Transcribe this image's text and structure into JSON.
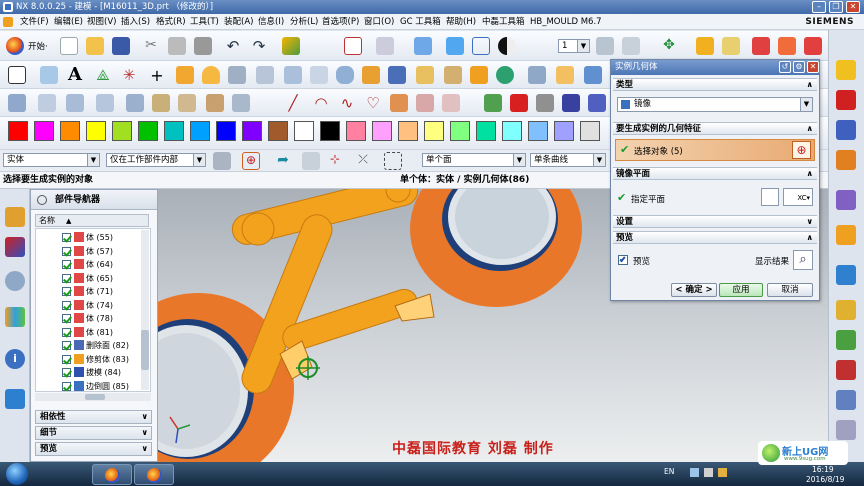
{
  "window": {
    "title": "NX 8.0.0.25 - 建模 - [M16011_3D.prt （修改的）]",
    "brand": "SIEMENS",
    "min": "–",
    "restore": "❐",
    "close": "✕"
  },
  "menu": [
    "文件(F)",
    "编辑(E)",
    "视图(V)",
    "插入(S)",
    "格式(R)",
    "工具(T)",
    "装配(A)",
    "信息(I)",
    "分析(L)",
    "首选项(P)",
    "窗口(O)",
    "GC 工具箱",
    "帮助(H)",
    "中磊工具箱",
    "HB_MOULD M6.7"
  ],
  "toolbar": {
    "start_label": "开始·",
    "layer_value": "1"
  },
  "palette": [
    "#ff0000",
    "#ff00ff",
    "#ff8c00",
    "#ffff00",
    "#a0e020",
    "#00c000",
    "#00c0c0",
    "#00a0ff",
    "#0000ff",
    "#8000ff",
    "#a05a2c",
    "#ffffff",
    "#000000",
    "#ff80a0",
    "#ffa0ff",
    "#ffc080",
    "#ffff80",
    "#80ff80",
    "#00e0a0",
    "#80ffff",
    "#80c0ff",
    "#a0a0ff",
    "#e0e0e0"
  ],
  "selection": {
    "type_filter": "实体",
    "scope": "仅在工作部件内部",
    "body_rule": "单个面",
    "curve_rule": "单条曲线"
  },
  "status": {
    "prompt": "选择要生成实例的对象",
    "message": "单个体：实体 / 实例几何体(86)"
  },
  "navigator": {
    "title": "部件导航器",
    "column": "名称",
    "rows": [
      {
        "label": "体 (55)"
      },
      {
        "label": "体 (57)"
      },
      {
        "label": "体 (64)"
      },
      {
        "label": "体 (65)"
      },
      {
        "label": "体 (71)"
      },
      {
        "label": "体 (74)"
      },
      {
        "label": "体 (78)"
      },
      {
        "label": "体 (81)"
      },
      {
        "label": "删除面 (82)"
      },
      {
        "label": "修剪体 (83)"
      },
      {
        "label": "拔模 (84)"
      },
      {
        "label": "边倒圆 (85)"
      }
    ],
    "panels": [
      "相依性",
      "细节",
      "预览"
    ]
  },
  "dialog": {
    "title": "实例几何体",
    "type_section": "类型",
    "type_value": "镜像",
    "geom_section": "要生成实例的几何特征",
    "select_object": "选择对象 (5)",
    "plane_section": "镜像平面",
    "specify_plane": "指定平面",
    "settings_section": "设置",
    "preview_section": "预览",
    "preview_check": "预览",
    "show_result": "显示结果",
    "ok": "< 确定 >",
    "apply": "应用",
    "cancel": "取消"
  },
  "watermark": "中磊国际教育    刘磊    制作",
  "tray": {
    "ime": "EN",
    "time": "16:19",
    "date": "2016/8/19",
    "logo_text": "新上UG网",
    "logo_url": "www.9sug.com"
  },
  "colors": {
    "part": "#f3a21e",
    "ring": "#e8772a",
    "select_bar": "#e8aa72",
    "accent": "#4a75b5"
  }
}
